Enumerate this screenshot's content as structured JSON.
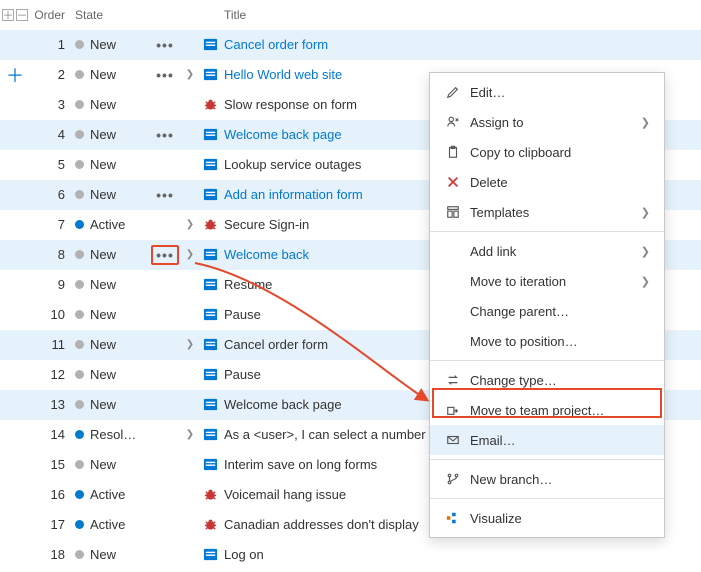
{
  "headers": {
    "order": "Order",
    "state": "State",
    "title": "Title"
  },
  "rows": [
    {
      "order": 1,
      "state": "New",
      "stateKind": "new",
      "type": "pbi",
      "title": "Cancel order form",
      "link": true,
      "hasActions": true,
      "expand": false,
      "selected": true
    },
    {
      "order": 2,
      "state": "New",
      "stateKind": "new",
      "type": "pbi",
      "title": "Hello World web site",
      "link": true,
      "hasActions": true,
      "expand": true,
      "selected": false,
      "gutterAdd": true
    },
    {
      "order": 3,
      "state": "New",
      "stateKind": "new",
      "type": "bug",
      "title": "Slow response on form",
      "link": false,
      "hasActions": false,
      "expand": false,
      "selected": false
    },
    {
      "order": 4,
      "state": "New",
      "stateKind": "new",
      "type": "pbi",
      "title": "Welcome back page",
      "link": true,
      "hasActions": true,
      "expand": false,
      "selected": true
    },
    {
      "order": 5,
      "state": "New",
      "stateKind": "new",
      "type": "pbi",
      "title": "Lookup service outages",
      "link": false,
      "hasActions": false,
      "expand": false,
      "selected": false
    },
    {
      "order": 6,
      "state": "New",
      "stateKind": "new",
      "type": "pbi",
      "title": "Add an information form",
      "link": true,
      "hasActions": true,
      "expand": false,
      "selected": true
    },
    {
      "order": 7,
      "state": "Active",
      "stateKind": "active",
      "type": "bug",
      "title": "Secure Sign-in",
      "link": false,
      "hasActions": false,
      "expand": true,
      "selected": false
    },
    {
      "order": 8,
      "state": "New",
      "stateKind": "new",
      "type": "pbi",
      "title": "Welcome back",
      "link": true,
      "hasActions": true,
      "expand": true,
      "selected": true,
      "actionsHighlighted": true
    },
    {
      "order": 9,
      "state": "New",
      "stateKind": "new",
      "type": "pbi",
      "title": "Resume",
      "link": false,
      "hasActions": false,
      "expand": false,
      "selected": false
    },
    {
      "order": 10,
      "state": "New",
      "stateKind": "new",
      "type": "pbi",
      "title": "Pause",
      "link": false,
      "hasActions": false,
      "expand": false,
      "selected": false
    },
    {
      "order": 11,
      "state": "New",
      "stateKind": "new",
      "type": "pbi",
      "title": "Cancel order form",
      "link": false,
      "hasActions": false,
      "expand": true,
      "selected": true
    },
    {
      "order": 12,
      "state": "New",
      "stateKind": "new",
      "type": "pbi",
      "title": "Pause",
      "link": false,
      "hasActions": false,
      "expand": false,
      "selected": false
    },
    {
      "order": 13,
      "state": "New",
      "stateKind": "new",
      "type": "pbi",
      "title": "Welcome back page",
      "link": false,
      "hasActions": false,
      "expand": false,
      "selected": true
    },
    {
      "order": 14,
      "state": "Resol…",
      "stateKind": "resolved",
      "type": "pbi",
      "title": "As a  <user>, I can select a number",
      "link": false,
      "hasActions": false,
      "expand": true,
      "selected": false
    },
    {
      "order": 15,
      "state": "New",
      "stateKind": "new",
      "type": "pbi",
      "title": "Interim save on long forms",
      "link": false,
      "hasActions": false,
      "expand": false,
      "selected": false
    },
    {
      "order": 16,
      "state": "Active",
      "stateKind": "active",
      "type": "bug",
      "title": "Voicemail hang issue",
      "link": false,
      "hasActions": false,
      "expand": false,
      "selected": false
    },
    {
      "order": 17,
      "state": "Active",
      "stateKind": "active",
      "type": "bug",
      "title": "Canadian addresses don't display",
      "link": false,
      "hasActions": false,
      "expand": false,
      "selected": false
    },
    {
      "order": 18,
      "state": "New",
      "stateKind": "new",
      "type": "pbi",
      "title": "Log on",
      "link": false,
      "hasActions": false,
      "expand": false,
      "selected": false
    }
  ],
  "menu": {
    "edit": "Edit…",
    "assign": "Assign to",
    "copy": "Copy to clipboard",
    "delete": "Delete",
    "templates": "Templates",
    "addlink": "Add link",
    "iteration": "Move to iteration",
    "parent": "Change parent…",
    "position": "Move to position…",
    "changetype": "Change type…",
    "moveteam": "Move to team project…",
    "email": "Email…",
    "branch": "New branch…",
    "visualize": "Visualize"
  }
}
